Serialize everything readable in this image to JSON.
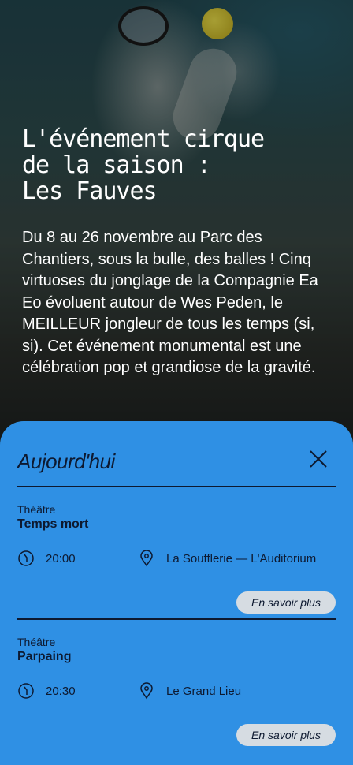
{
  "hero": {
    "title_lines": [
      "L'événement cirque",
      "de la saison :",
      "Les Fauves"
    ],
    "description": "Du 8 au 26 novembre au Parc des Chantiers, sous la bulle, des balles ! Cinq virtuoses du jonglage de la Compagnie Ea Eo évoluent autour de Wes Peden, le MEILLEUR jongleur de tous les temps (si, si). Cet événement monumental est une célébration pop et grandiose de la gravité."
  },
  "panel": {
    "title": "Aujourd'hui",
    "close_icon": "close-icon",
    "accent_color": "#2f90e4",
    "events": [
      {
        "category": "Théâtre",
        "name": "Temps mort",
        "time": "20:00",
        "venue": "La Soufflerie — L'Auditorium",
        "more_label": "En savoir plus"
      },
      {
        "category": "Théâtre",
        "name": "Parpaing",
        "time": "20:30",
        "venue": "Le Grand Lieu",
        "more_label": "En savoir plus"
      }
    ]
  }
}
